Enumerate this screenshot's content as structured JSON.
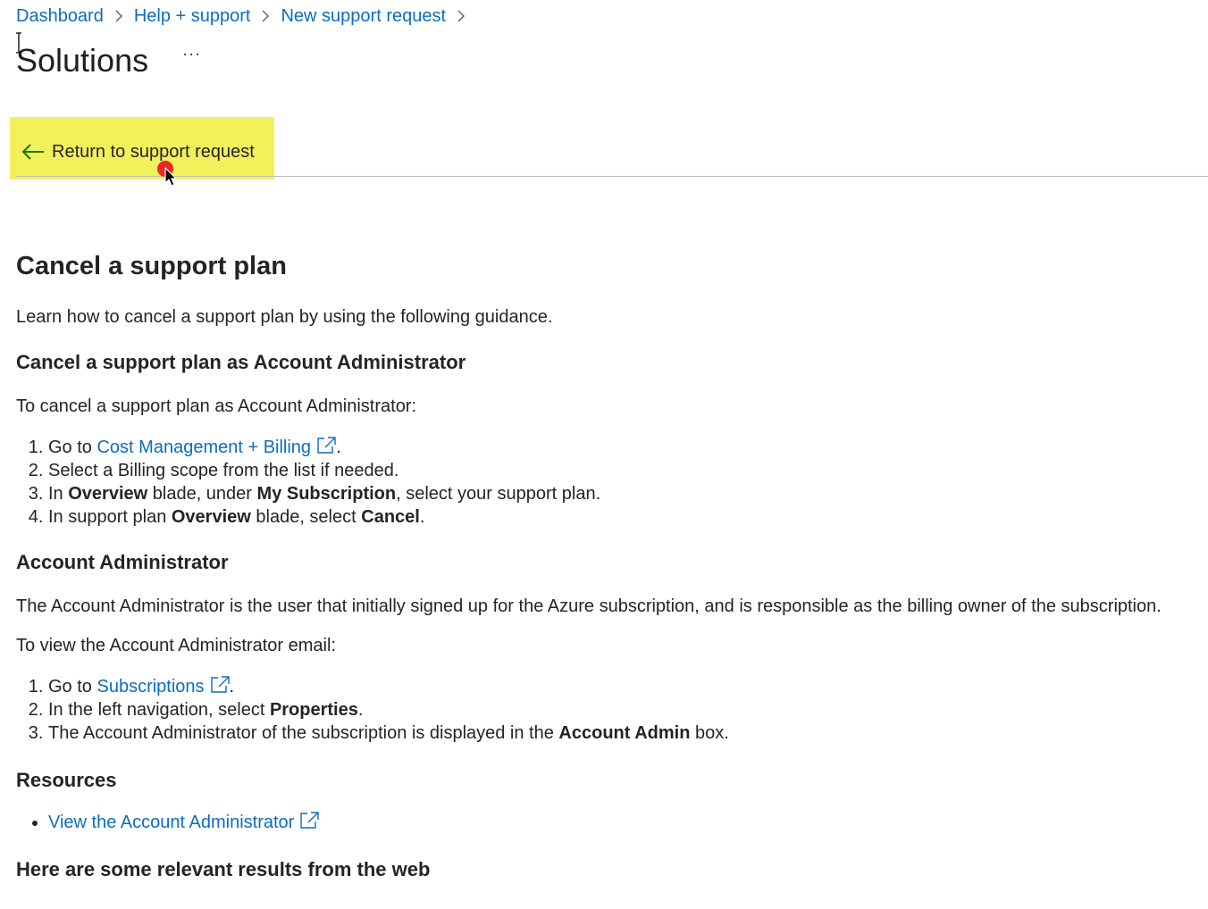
{
  "breadcrumb": {
    "items": [
      "Dashboard",
      "Help + support",
      "New support request"
    ]
  },
  "header": {
    "title": "Solutions",
    "more_label": "···"
  },
  "return_button": {
    "label": "Return to support request"
  },
  "article": {
    "title": "Cancel a support plan",
    "intro": "Learn how to cancel a support plan by using the following guidance.",
    "section1": {
      "heading": "Cancel a support plan as Account Administrator",
      "lead": "To cancel a support plan as Account Administrator:",
      "step1_prefix": "Go to ",
      "step1_link": "Cost Management + Billing",
      "step1_suffix": ".",
      "step2": "Select a Billing scope from the list if needed.",
      "step3_a": "In ",
      "step3_b": "Overview",
      "step3_c": " blade, under ",
      "step3_d": "My Subscription",
      "step3_e": ", select your support plan.",
      "step4_a": "In support plan ",
      "step4_b": "Overview",
      "step4_c": " blade, select ",
      "step4_d": "Cancel",
      "step4_e": "."
    },
    "section2": {
      "heading": "Account Administrator",
      "description": "The Account Administrator is the user that initially signed up for the Azure subscription, and is responsible as the billing owner of the subscription.",
      "lead": "To view the Account Administrator email:",
      "step1_prefix": "Go to ",
      "step1_link": "Subscriptions",
      "step1_suffix": ".",
      "step2_a": "In the left navigation, select ",
      "step2_b": "Properties",
      "step2_c": ".",
      "step3_a": "The Account Administrator of the subscription is displayed in the ",
      "step3_b": "Account Admin",
      "step3_c": " box."
    },
    "resources": {
      "heading": "Resources",
      "links": [
        "View the Account Administrator"
      ]
    },
    "web_results_heading": "Here are some relevant results from the web"
  },
  "colors": {
    "link": "#0f6cbd",
    "highlight": "#f0ee3e",
    "text": "#242424",
    "arrow": "#107c10",
    "click_marker": "#e81123"
  },
  "icons": {
    "return": "arrow-left-icon",
    "external": "external-link-icon",
    "separator": "chevron-right-icon",
    "more": "more-icon"
  }
}
